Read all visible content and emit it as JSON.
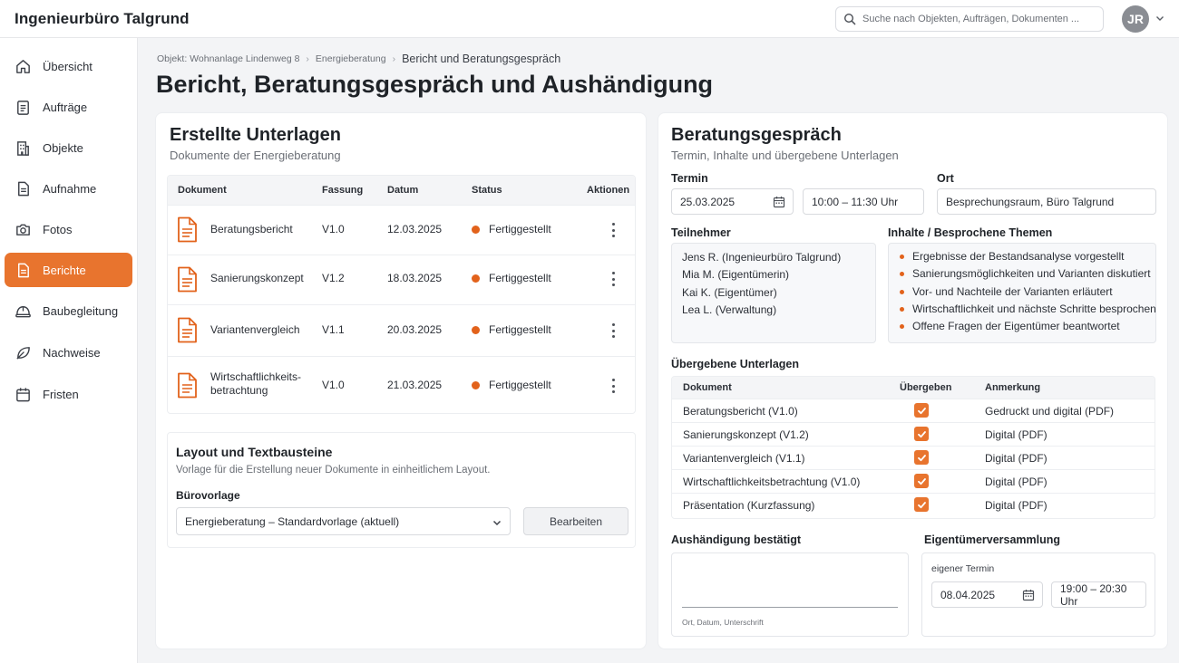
{
  "app": {
    "title": "Ingenieurbüro Talgrund"
  },
  "search": {
    "placeholder": "Suche nach Objekten, Aufträgen, Dokumenten ..."
  },
  "user": {
    "initials": "JR"
  },
  "colors": {
    "accent": "#e8742e",
    "status_dot": "#e2621b"
  },
  "sidebar": {
    "items": [
      {
        "label": "Übersicht",
        "icon": "home-icon"
      },
      {
        "label": "Aufträge",
        "icon": "clipboard-list-icon"
      },
      {
        "label": "Objekte",
        "icon": "building-icon"
      },
      {
        "label": "Aufnahme",
        "icon": "document-icon"
      },
      {
        "label": "Fotos",
        "icon": "camera-icon"
      },
      {
        "label": "Berichte",
        "icon": "report-icon",
        "active": true
      },
      {
        "label": "Baubegleitung",
        "icon": "helmet-icon"
      },
      {
        "label": "Nachweise",
        "icon": "leaf-icon"
      },
      {
        "label": "Fristen",
        "icon": "calendar-icon"
      }
    ]
  },
  "breadcrumb": {
    "items": [
      "Objekt: Wohnanlage Lindenweg 8",
      "Energieberatung",
      "Bericht und Beratungsgespräch"
    ]
  },
  "page": {
    "title": "Bericht, Beratungsgespräch und Aushändigung"
  },
  "documents": {
    "title": "Erstellte Unterlagen",
    "subtitle": "Dokumente der Energieberatung",
    "headers": [
      "Dokument",
      "Fassung",
      "Datum",
      "Status",
      "Aktionen"
    ],
    "rows": [
      {
        "name": "Beratungsbericht",
        "version": "V1.0",
        "date": "12.03.2025",
        "status": "Fertiggestellt"
      },
      {
        "name": "Sanierungskonzept",
        "version": "V1.2",
        "date": "18.03.2025",
        "status": "Fertiggestellt"
      },
      {
        "name": "Variantenvergleich",
        "version": "V1.1",
        "date": "20.03.2025",
        "status": "Fertiggestellt"
      },
      {
        "name": "Wirtschaftlichkeits-\nbetrachtung",
        "version": "V1.0",
        "date": "21.03.2025",
        "status": "Fertiggestellt"
      }
    ]
  },
  "layout": {
    "title": "Layout und Textbausteine",
    "subtitle": "Vorlage für die Erstellung neuer Dokumente in einheitlichem Layout.",
    "template_label": "Bürovorlage",
    "template_value": "Energieberatung – Standardvorlage (aktuell)",
    "edit_label": "Bearbeiten"
  },
  "consultation": {
    "title": "Beratungsgespräch",
    "subtitle": "Termin, Inhalte und übergebene Unterlagen",
    "date_label": "Termin",
    "date_value": "25.03.2025",
    "time_value": "10:00 – 11:30 Uhr",
    "location_label": "Ort",
    "location_value": "Besprechungsraum, Büro Talgrund",
    "participants_label": "Teilnehmer",
    "participants": [
      "Jens R. (Ingenieurbüro Talgrund)",
      "Mia M. (Eigentümerin)",
      "Kai K. (Eigentümer)",
      "Lea L. (Verwaltung)"
    ],
    "topics_label": "Inhalte / Besprochene Themen",
    "topics": [
      "Ergebnisse der Bestandsanalyse vorgestellt",
      "Sanierungsmöglichkeiten und Varianten diskutiert",
      "Vor- und Nachteile der Varianten erläutert",
      "Wirtschaftlichkeit und nächste Schritte besprochen",
      "Offene Fragen der Eigentümer beantwortet"
    ],
    "handover_label": "Übergebene Unterlagen",
    "handover_headers": [
      "Dokument",
      "Übergeben",
      "Anmerkung"
    ],
    "handover_rows": [
      {
        "doc": "Beratungsbericht (V1.0)",
        "handed": true,
        "note": "Gedruckt und digital (PDF)"
      },
      {
        "doc": "Sanierungskonzept (V1.2)",
        "handed": true,
        "note": "Digital (PDF)"
      },
      {
        "doc": "Variantenvergleich (V1.1)",
        "handed": true,
        "note": "Digital (PDF)"
      },
      {
        "doc": "Wirtschaftlichkeitsbetrachtung (V1.0)",
        "handed": true,
        "note": "Digital (PDF)"
      },
      {
        "doc": "Präsentation (Kurzfassung)",
        "handed": true,
        "note": "Digital (PDF)"
      }
    ],
    "confirm_label": "Aushändigung bestätigt",
    "signature_hint": "Ort, Datum, Unterschrift",
    "assembly_label": "Eigentümerversammlung",
    "assembly_sub": "eigener Termin",
    "assembly_date": "08.04.2025",
    "assembly_time": "19:00 – 20:30 Uhr"
  }
}
